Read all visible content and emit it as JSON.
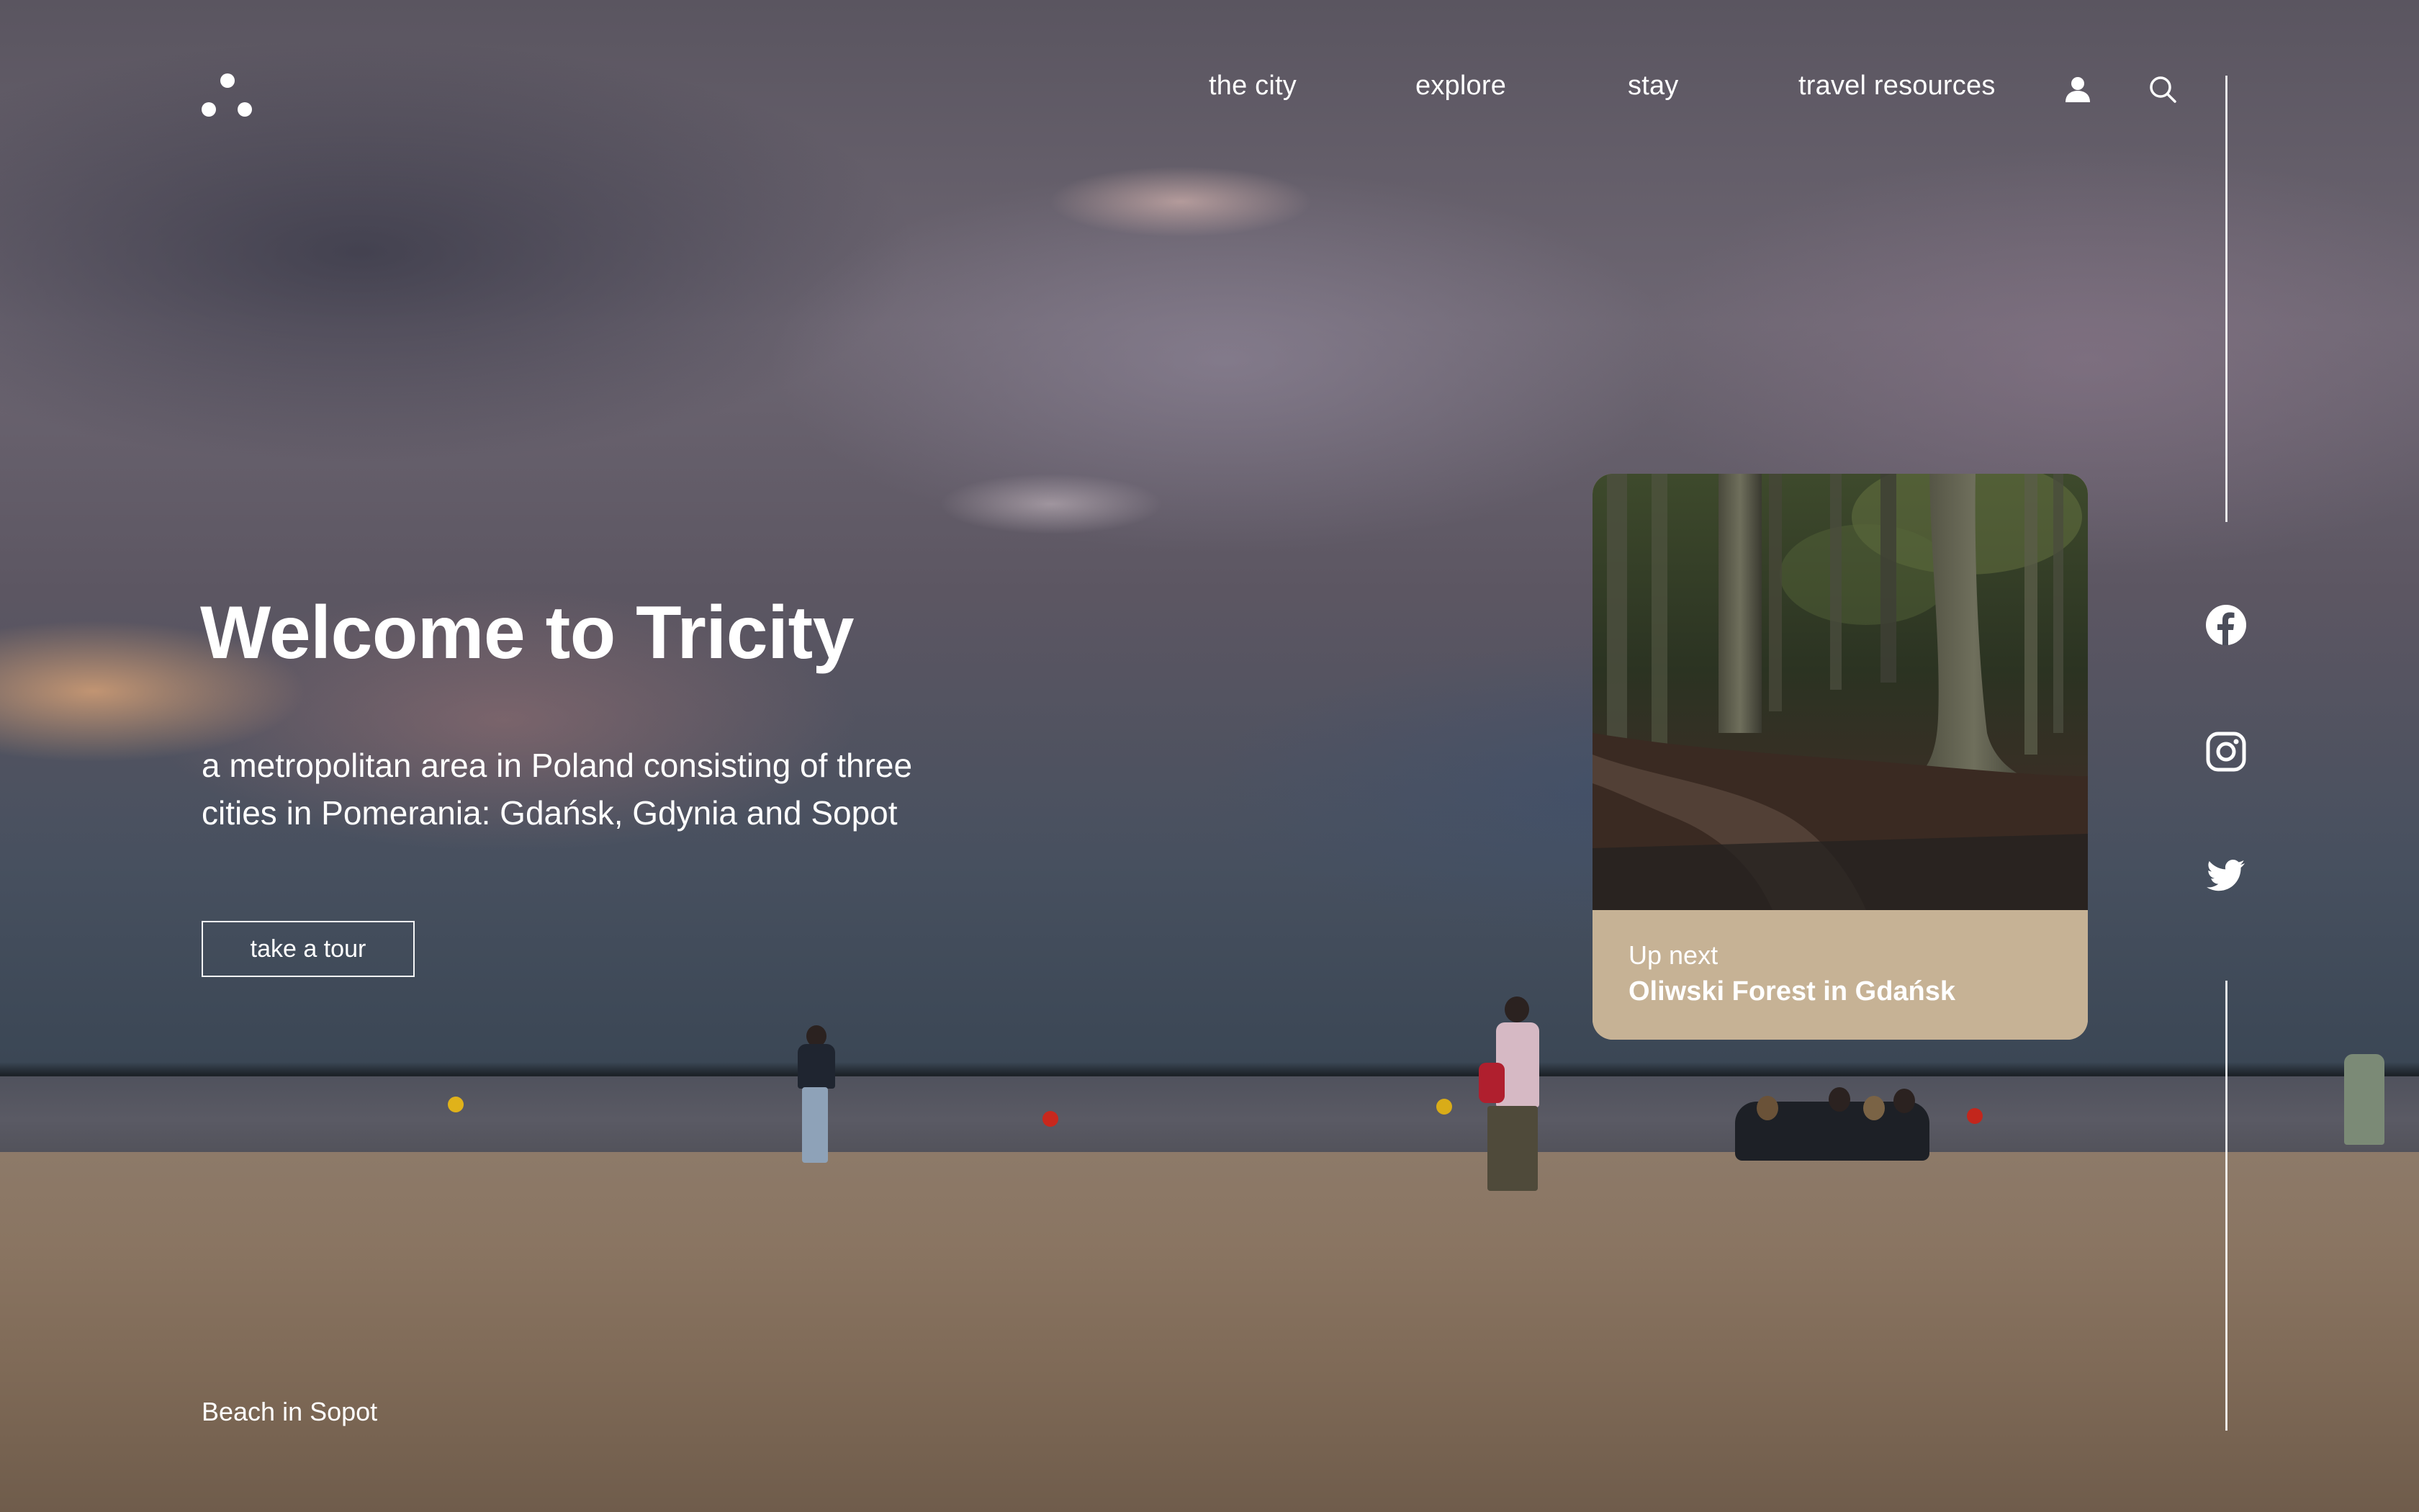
{
  "brand": {
    "logo_icon": "three-dots-logo-icon"
  },
  "nav": {
    "items": [
      {
        "label": "the city"
      },
      {
        "label": "explore"
      },
      {
        "label": "stay"
      },
      {
        "label": "travel resources"
      }
    ],
    "account_icon": "user-icon",
    "search_icon": "search-icon"
  },
  "hero": {
    "title": "Welcome to Tricity",
    "subtitle": "a metropolitan area in Poland consisting of three cities in Pomerania: Gdańsk, Gdynia and Sopot",
    "cta_label": "take a tour",
    "photo_caption": "Beach in Sopot"
  },
  "up_next": {
    "kicker": "Up next",
    "title": "Oliwski Forest in Gdańsk",
    "footer_color": "#c6b295"
  },
  "social": [
    {
      "icon": "facebook-icon"
    },
    {
      "icon": "instagram-icon"
    },
    {
      "icon": "twitter-icon"
    }
  ]
}
